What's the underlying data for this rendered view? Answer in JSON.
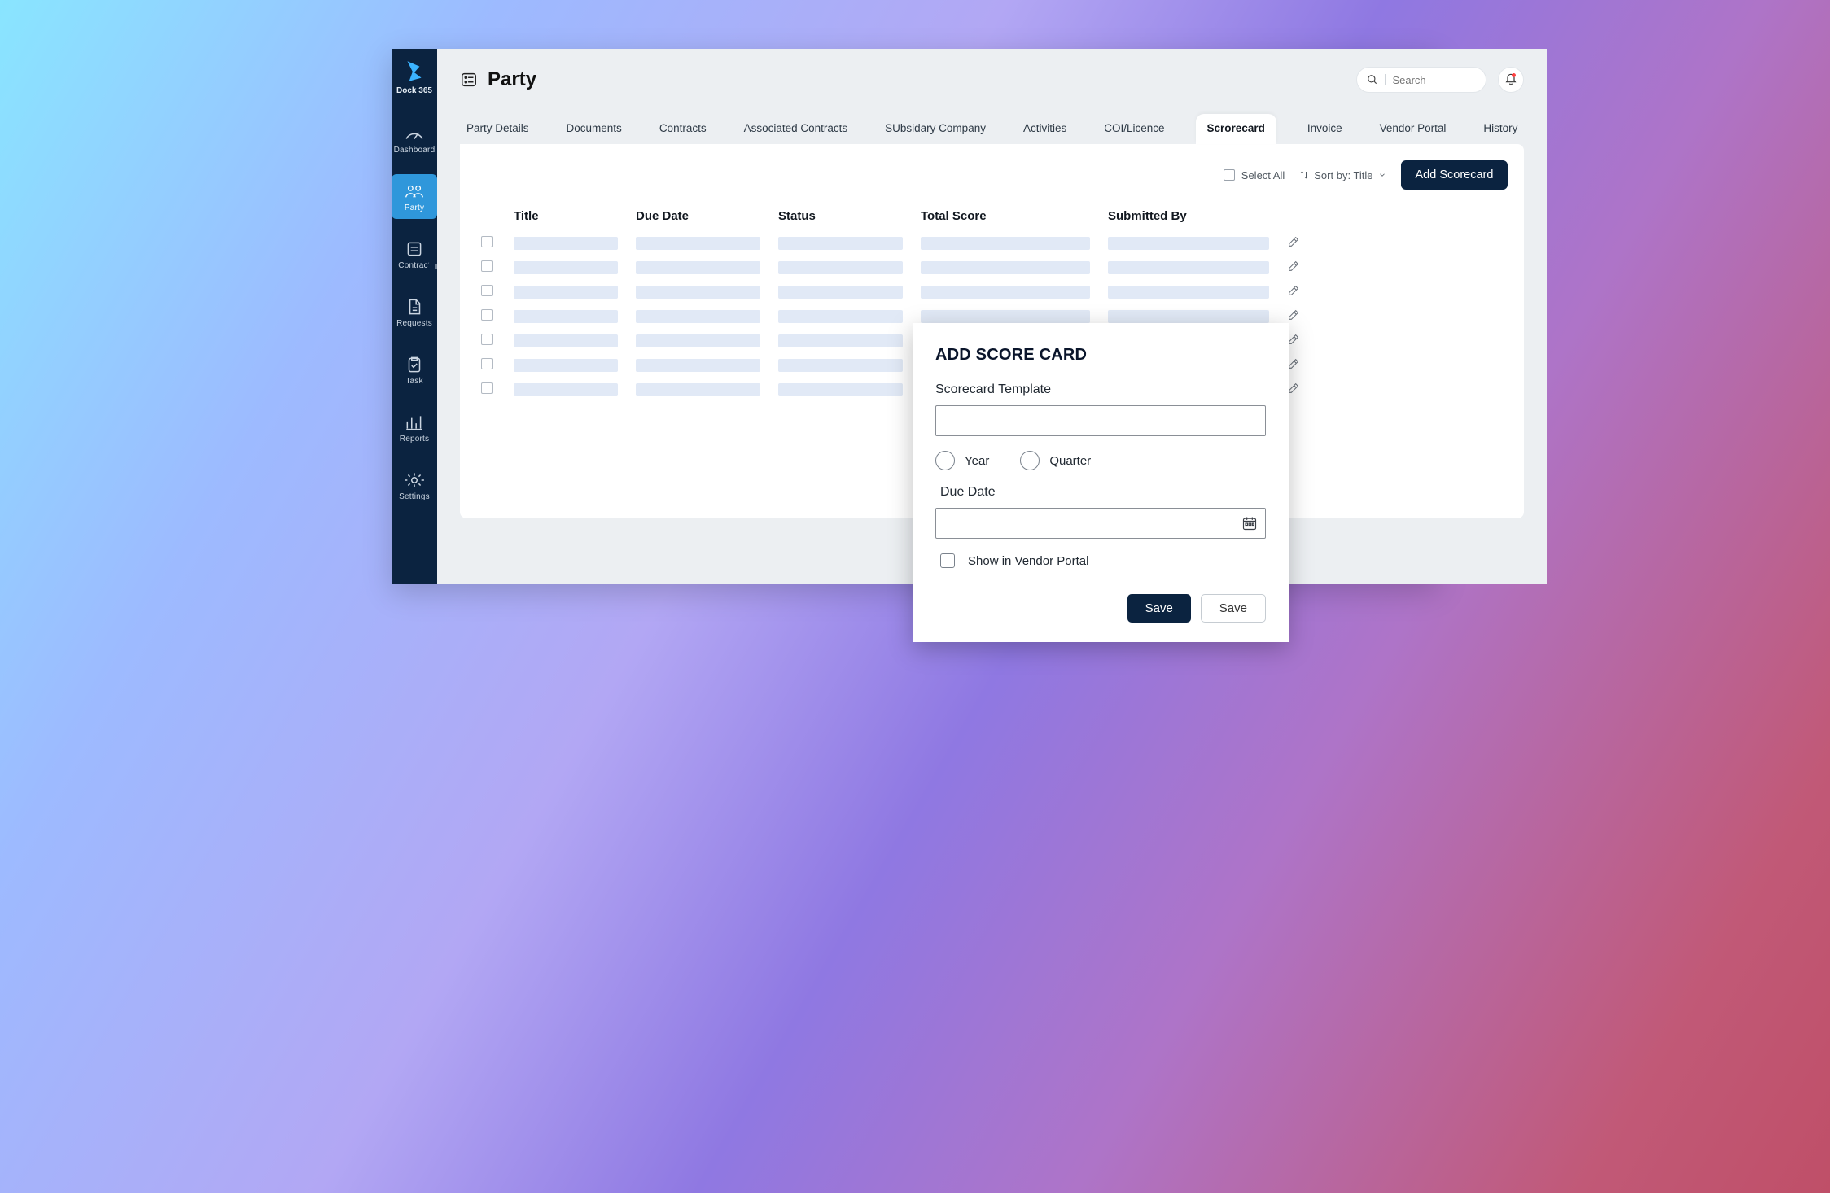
{
  "brand": {
    "name": "Dock 365"
  },
  "sidebar": {
    "items": [
      {
        "label": "Dashboard"
      },
      {
        "label": "Party"
      },
      {
        "label": "Contract"
      },
      {
        "label": "Requests"
      },
      {
        "label": "Task"
      },
      {
        "label": "Reports"
      },
      {
        "label": "Settings"
      }
    ]
  },
  "header": {
    "title": "Party",
    "search_placeholder": "Search"
  },
  "tabs": [
    {
      "label": "Party Details"
    },
    {
      "label": "Documents"
    },
    {
      "label": "Contracts"
    },
    {
      "label": "Associated Contracts"
    },
    {
      "label": "SUbsidary Company"
    },
    {
      "label": "Activities"
    },
    {
      "label": "COI/Licence"
    },
    {
      "label": "Scrorecard",
      "active": true
    },
    {
      "label": "Invoice"
    },
    {
      "label": "Vendor Portal"
    },
    {
      "label": "History"
    }
  ],
  "toolbar": {
    "select_all": "Select All",
    "sort_by": "Sort by: Title",
    "add_button": "Add Scorecard"
  },
  "table": {
    "headers": [
      "Title",
      "Due Date",
      "Status",
      "Total Score",
      "Submitted By"
    ],
    "row_count": 7
  },
  "modal": {
    "title": "ADD SCORE CARD",
    "template_label": "Scorecard Template",
    "template_value": "",
    "radio_year": "Year",
    "radio_quarter": "Quarter",
    "due_date_label": "Due Date",
    "due_date_value": "",
    "show_vendor": "Show in Vendor Portal",
    "save_primary": "Save",
    "save_secondary": "Save"
  }
}
